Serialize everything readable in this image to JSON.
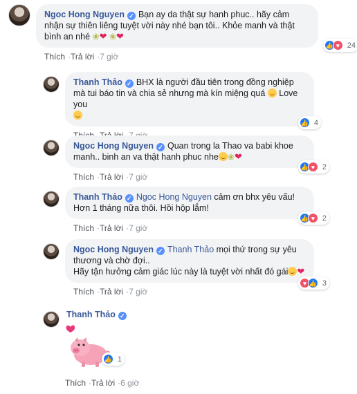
{
  "comments": [
    {
      "name": "Ngoc Hong Nguyen",
      "text": "Bạn ay da thật sự hanh phuc.. hãy cảm nhận sự thiên liêng tuyệt vời này nhé bạn tôi.. Khỏe manh và thật bình an nhé",
      "reaction_count": "24",
      "like": "Thích",
      "reply": "Trả lời",
      "time": "7 giờ"
    },
    {
      "name": "Thanh Thảo",
      "text": "BHX là người đầu tiên trong đồng nghiệp mà tui báo tin và chia sẻ nhưng mà kín miệng quá",
      "text_end": "Love you",
      "reaction_count": "4",
      "like": "Thích",
      "reply": "Trả lời",
      "time": "7 giờ"
    },
    {
      "name": "Ngoc Hong Nguyen",
      "text": "Quan trong la Thao va babi khoe manh.. binh an va thật hanh phuc nhe",
      "reaction_count": "2",
      "like": "Thích",
      "reply": "Trả lời",
      "time": "7 giờ"
    },
    {
      "name": "Thanh Thảo",
      "mention": "Ngoc Hong Nguyen",
      "text": "cảm ơn bhx yêu vấu! Hơn 1 tháng nữa thôi. Hồi hộp lắm!",
      "reaction_count": "2",
      "like": "Thích",
      "reply": "Trả lời",
      "time": "7 giờ"
    },
    {
      "name": "Ngoc Hong Nguyen",
      "mention": "Thanh Thảo",
      "text": "mọi thứ trong sự yêu thương và chờ đợi..",
      "text2": "Hãy tận hưởng cảm giác lúc này là tuyệt vời nhất đó gái",
      "reaction_count": "3",
      "like": "Thích",
      "reply": "Trả lời",
      "time": "7 giờ"
    },
    {
      "name": "Thanh Thảo",
      "reaction_count": "1",
      "like": "Thích",
      "reply": "Trả lời",
      "time": "6 giờ"
    }
  ],
  "icons": {
    "verified": "verified-badge-icon",
    "like": "like-reaction-icon",
    "love": "love-reaction-icon",
    "sticker": "pig-sticker-icon"
  },
  "colors": {
    "name": "#385898",
    "bubble": "#f2f3f5",
    "like": "#2078f4",
    "love": "#f25268"
  }
}
